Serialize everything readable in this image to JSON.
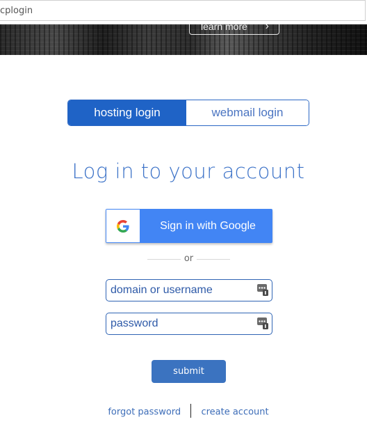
{
  "browser": {
    "url": "cplogin"
  },
  "hero": {
    "learn_more": "learn more"
  },
  "tabs": [
    {
      "label": "hosting login",
      "active": true
    },
    {
      "label": "webmail login",
      "active": false
    }
  ],
  "title": "Log in to your account",
  "google": {
    "label": "Sign in with Google"
  },
  "divider": {
    "text": "or"
  },
  "fields": {
    "username": {
      "placeholder": "domain or username",
      "value": ""
    },
    "password": {
      "placeholder": "password",
      "value": ""
    }
  },
  "submit": {
    "label": "submit"
  },
  "links": {
    "forgot": "forgot password",
    "create": "create account"
  },
  "colors": {
    "brand_blue": "#1f63c6",
    "google_blue": "#4285f4",
    "submit_blue": "#3b73c0"
  }
}
